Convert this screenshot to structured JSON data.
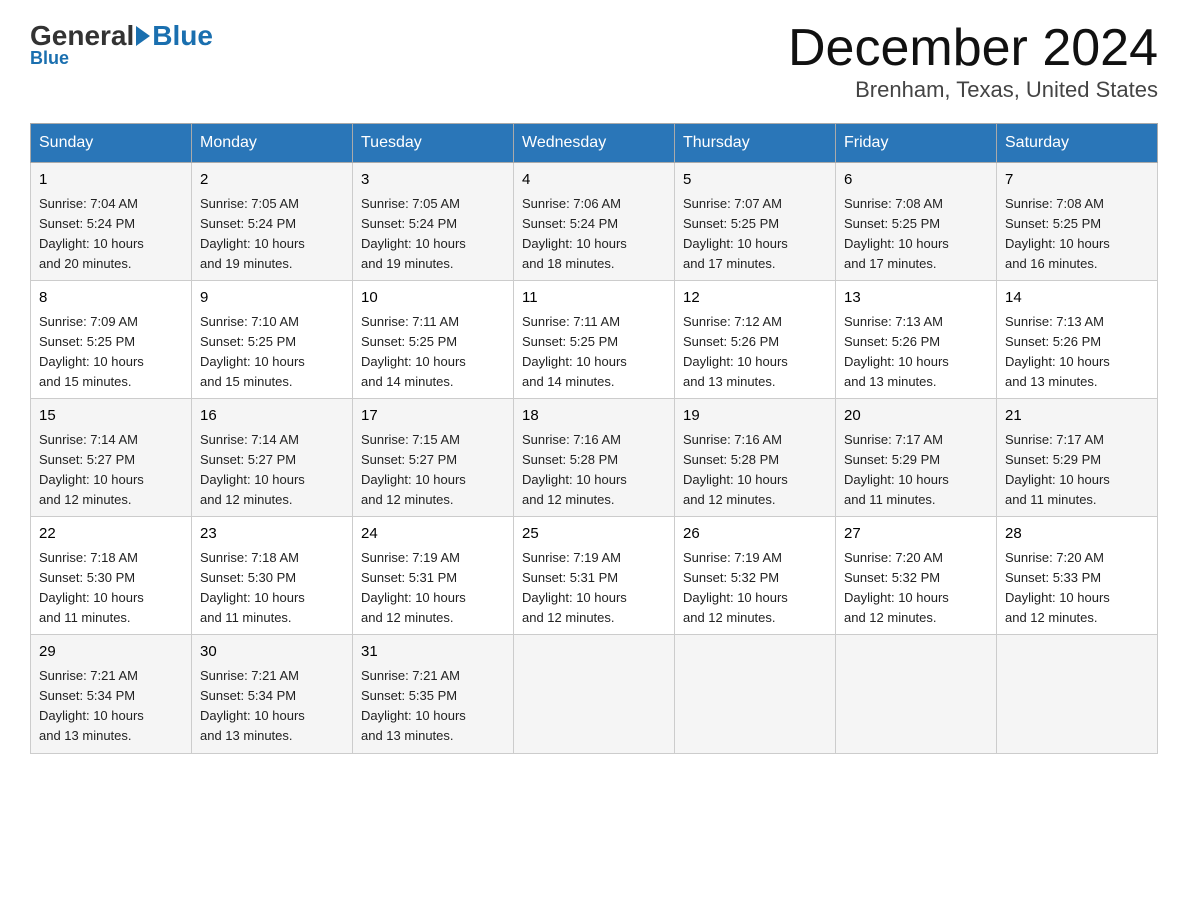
{
  "logo": {
    "general": "General",
    "blue": "Blue",
    "subtitle": "Blue"
  },
  "title": "December 2024",
  "location": "Brenham, Texas, United States",
  "days_of_week": [
    "Sunday",
    "Monday",
    "Tuesday",
    "Wednesday",
    "Thursday",
    "Friday",
    "Saturday"
  ],
  "weeks": [
    [
      {
        "day": "1",
        "sunrise": "7:04 AM",
        "sunset": "5:24 PM",
        "daylight": "10 hours and 20 minutes."
      },
      {
        "day": "2",
        "sunrise": "7:05 AM",
        "sunset": "5:24 PM",
        "daylight": "10 hours and 19 minutes."
      },
      {
        "day": "3",
        "sunrise": "7:05 AM",
        "sunset": "5:24 PM",
        "daylight": "10 hours and 19 minutes."
      },
      {
        "day": "4",
        "sunrise": "7:06 AM",
        "sunset": "5:24 PM",
        "daylight": "10 hours and 18 minutes."
      },
      {
        "day": "5",
        "sunrise": "7:07 AM",
        "sunset": "5:25 PM",
        "daylight": "10 hours and 17 minutes."
      },
      {
        "day": "6",
        "sunrise": "7:08 AM",
        "sunset": "5:25 PM",
        "daylight": "10 hours and 17 minutes."
      },
      {
        "day": "7",
        "sunrise": "7:08 AM",
        "sunset": "5:25 PM",
        "daylight": "10 hours and 16 minutes."
      }
    ],
    [
      {
        "day": "8",
        "sunrise": "7:09 AM",
        "sunset": "5:25 PM",
        "daylight": "10 hours and 15 minutes."
      },
      {
        "day": "9",
        "sunrise": "7:10 AM",
        "sunset": "5:25 PM",
        "daylight": "10 hours and 15 minutes."
      },
      {
        "day": "10",
        "sunrise": "7:11 AM",
        "sunset": "5:25 PM",
        "daylight": "10 hours and 14 minutes."
      },
      {
        "day": "11",
        "sunrise": "7:11 AM",
        "sunset": "5:25 PM",
        "daylight": "10 hours and 14 minutes."
      },
      {
        "day": "12",
        "sunrise": "7:12 AM",
        "sunset": "5:26 PM",
        "daylight": "10 hours and 13 minutes."
      },
      {
        "day": "13",
        "sunrise": "7:13 AM",
        "sunset": "5:26 PM",
        "daylight": "10 hours and 13 minutes."
      },
      {
        "day": "14",
        "sunrise": "7:13 AM",
        "sunset": "5:26 PM",
        "daylight": "10 hours and 13 minutes."
      }
    ],
    [
      {
        "day": "15",
        "sunrise": "7:14 AM",
        "sunset": "5:27 PM",
        "daylight": "10 hours and 12 minutes."
      },
      {
        "day": "16",
        "sunrise": "7:14 AM",
        "sunset": "5:27 PM",
        "daylight": "10 hours and 12 minutes."
      },
      {
        "day": "17",
        "sunrise": "7:15 AM",
        "sunset": "5:27 PM",
        "daylight": "10 hours and 12 minutes."
      },
      {
        "day": "18",
        "sunrise": "7:16 AM",
        "sunset": "5:28 PM",
        "daylight": "10 hours and 12 minutes."
      },
      {
        "day": "19",
        "sunrise": "7:16 AM",
        "sunset": "5:28 PM",
        "daylight": "10 hours and 12 minutes."
      },
      {
        "day": "20",
        "sunrise": "7:17 AM",
        "sunset": "5:29 PM",
        "daylight": "10 hours and 11 minutes."
      },
      {
        "day": "21",
        "sunrise": "7:17 AM",
        "sunset": "5:29 PM",
        "daylight": "10 hours and 11 minutes."
      }
    ],
    [
      {
        "day": "22",
        "sunrise": "7:18 AM",
        "sunset": "5:30 PM",
        "daylight": "10 hours and 11 minutes."
      },
      {
        "day": "23",
        "sunrise": "7:18 AM",
        "sunset": "5:30 PM",
        "daylight": "10 hours and 11 minutes."
      },
      {
        "day": "24",
        "sunrise": "7:19 AM",
        "sunset": "5:31 PM",
        "daylight": "10 hours and 12 minutes."
      },
      {
        "day": "25",
        "sunrise": "7:19 AM",
        "sunset": "5:31 PM",
        "daylight": "10 hours and 12 minutes."
      },
      {
        "day": "26",
        "sunrise": "7:19 AM",
        "sunset": "5:32 PM",
        "daylight": "10 hours and 12 minutes."
      },
      {
        "day": "27",
        "sunrise": "7:20 AM",
        "sunset": "5:32 PM",
        "daylight": "10 hours and 12 minutes."
      },
      {
        "day": "28",
        "sunrise": "7:20 AM",
        "sunset": "5:33 PM",
        "daylight": "10 hours and 12 minutes."
      }
    ],
    [
      {
        "day": "29",
        "sunrise": "7:21 AM",
        "sunset": "5:34 PM",
        "daylight": "10 hours and 13 minutes."
      },
      {
        "day": "30",
        "sunrise": "7:21 AM",
        "sunset": "5:34 PM",
        "daylight": "10 hours and 13 minutes."
      },
      {
        "day": "31",
        "sunrise": "7:21 AM",
        "sunset": "5:35 PM",
        "daylight": "10 hours and 13 minutes."
      },
      null,
      null,
      null,
      null
    ]
  ],
  "labels": {
    "sunrise": "Sunrise:",
    "sunset": "Sunset:",
    "daylight": "Daylight:"
  }
}
